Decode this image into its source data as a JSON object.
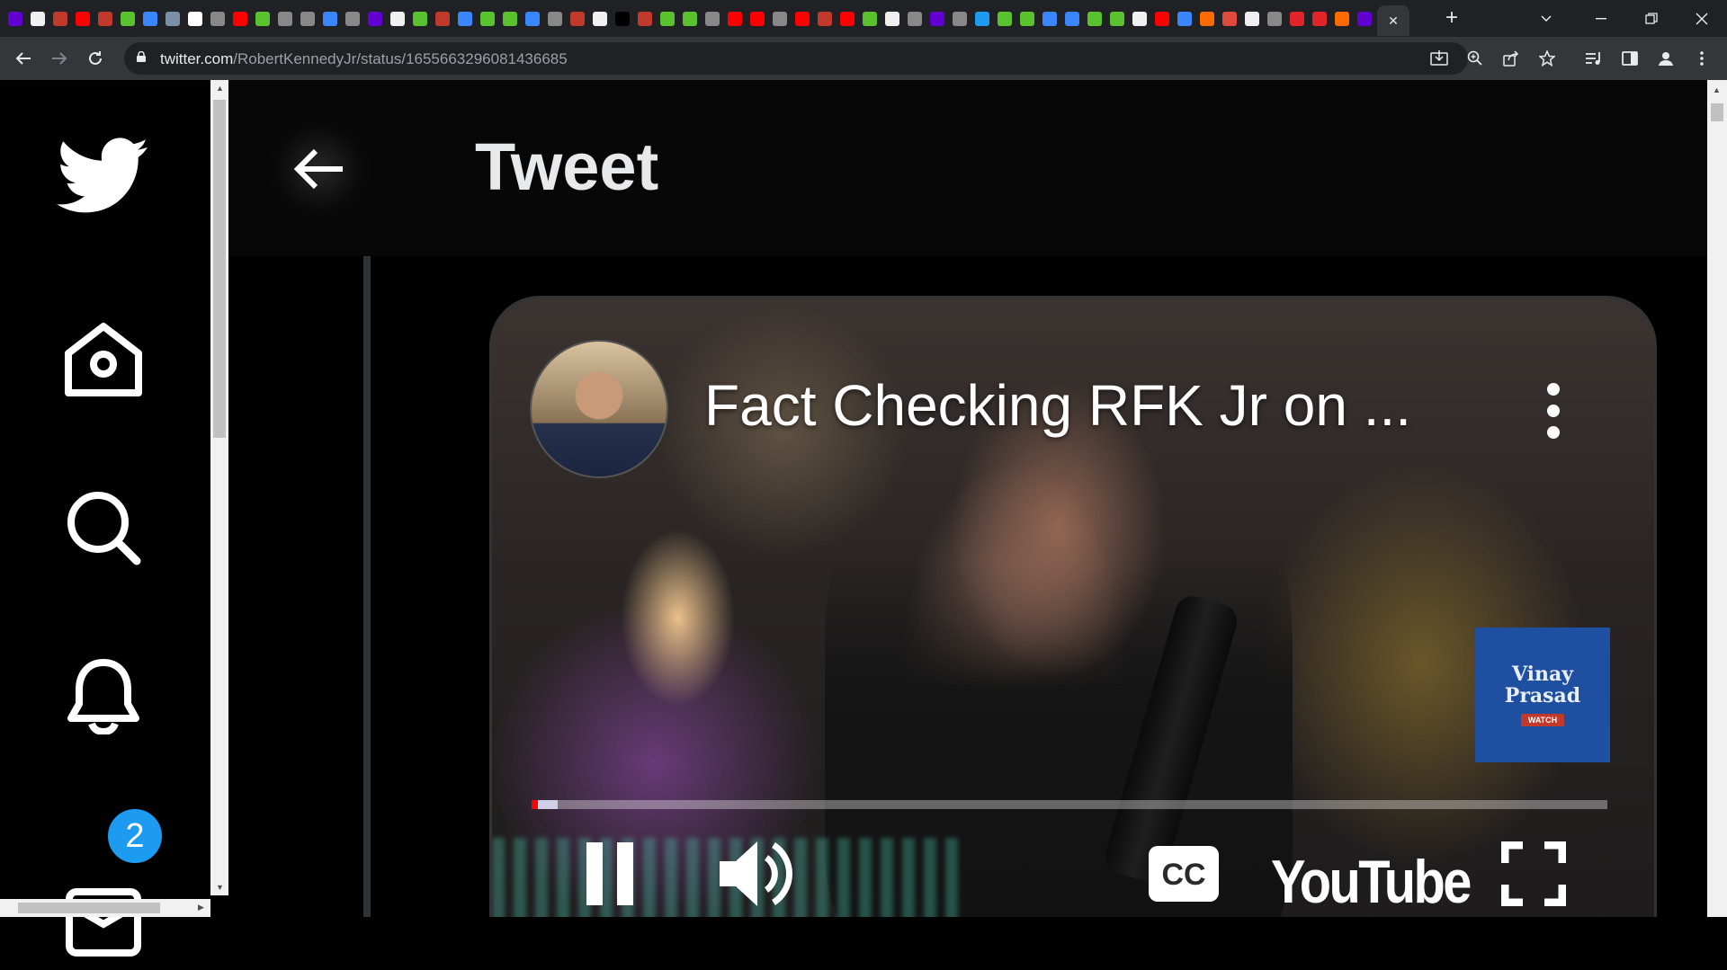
{
  "browser": {
    "url_host": "twitter.com",
    "url_path": "/RobertKennedyJr/status/1655663296081436685"
  },
  "tabs": {
    "count_visible": 60,
    "favicon_colors": [
      "#6001d2",
      "#f0f0f0",
      "#c0392b",
      "#ff0000",
      "#c0392b",
      "#5ac12e",
      "#3a86ff",
      "#7b8fa6",
      "#ffffff",
      "#888",
      "#ff0000",
      "#5ac12e",
      "#888",
      "#888",
      "#3a86ff",
      "#888",
      "#6001d2",
      "#f0f0f0",
      "#5ac12e",
      "#c0392b",
      "#3a86ff",
      "#5ac12e",
      "#5ac12e",
      "#3a86ff",
      "#888",
      "#c0392b",
      "#f0f0f0",
      "#000",
      "#c0392b",
      "#5ac12e",
      "#5ac12e",
      "#888",
      "#ff0000",
      "#ff0000",
      "#888",
      "#ff0000",
      "#c0392b",
      "#ff0000",
      "#5ac12e",
      "#f0f0f0",
      "#888",
      "#6001d2",
      "#888",
      "#1d9bf0",
      "#5ac12e",
      "#5ac12e",
      "#3a86ff",
      "#3a86ff",
      "#5ac12e",
      "#5ac12e",
      "#f0f0f0",
      "#ff0000",
      "#3a86ff",
      "#ff6a00",
      "#e04a3a",
      "#f0f0f0",
      "#888",
      "#e0242a",
      "#e0242a",
      "#ff6a00",
      "#6001d2"
    ]
  },
  "page": {
    "header_title": "Tweet",
    "notification_badge": "2"
  },
  "video": {
    "title": "Fact Checking RFK Jr on ...",
    "endcard_name": "Vinay Prasad",
    "endcard_button": "WATCH",
    "brand": "YouTube",
    "progress_fraction": 0.006,
    "buffer_fraction": 0.02
  },
  "colors": {
    "accent": "#1d9bf0",
    "progress_played": "#ff0000"
  },
  "icons": {
    "nav": [
      "twitter-logo-icon",
      "home-icon",
      "search-icon",
      "bell-icon",
      "mail-icon"
    ],
    "player": [
      "pause-icon",
      "volume-icon",
      "cc-icon",
      "fullscreen-icon",
      "more-vertical-icon"
    ]
  }
}
